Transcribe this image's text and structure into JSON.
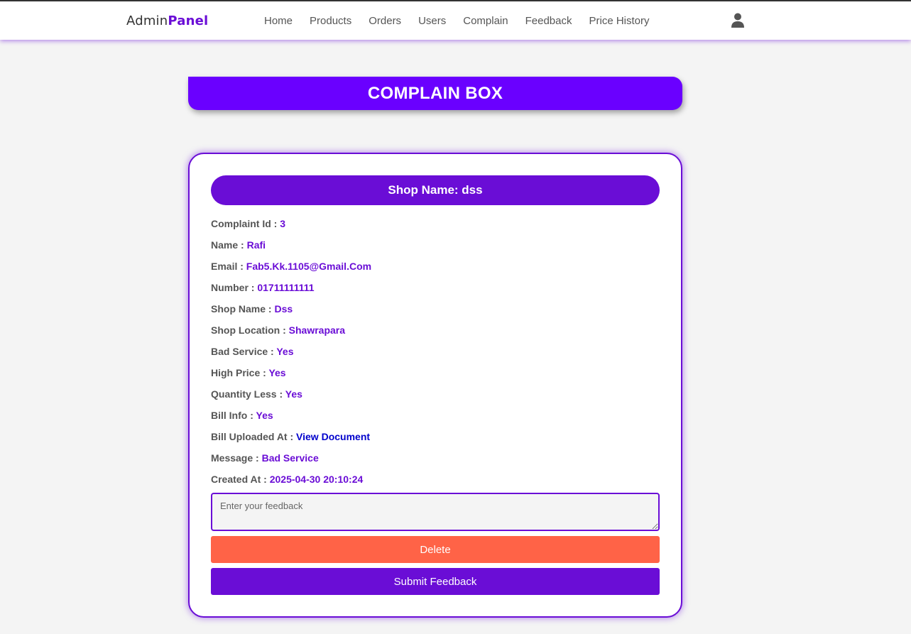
{
  "brand": {
    "part1": "Admin",
    "part2": "Panel"
  },
  "nav": {
    "items": [
      "Home",
      "Products",
      "Orders",
      "Users",
      "Complain",
      "Feedback",
      "Price History"
    ]
  },
  "header": {
    "icon": "user-icon"
  },
  "banner": {
    "title": "COMPLAIN BOX"
  },
  "complaint": {
    "shop_pill": "Shop Name: dss",
    "fields": [
      {
        "label": "Complaint Id : ",
        "value": "3"
      },
      {
        "label": "Name : ",
        "value": "Rafi"
      },
      {
        "label": "Email : ",
        "value": "Fab5.Kk.1105@Gmail.Com"
      },
      {
        "label": "Number : ",
        "value": "01711111111"
      },
      {
        "label": "Shop Name : ",
        "value": "Dss"
      },
      {
        "label": "Shop Location : ",
        "value": "Shawrapara"
      },
      {
        "label": "Bad Service : ",
        "value": "Yes"
      },
      {
        "label": "High Price : ",
        "value": "Yes"
      },
      {
        "label": "Quantity Less : ",
        "value": "Yes"
      },
      {
        "label": "Bill Info : ",
        "value": "Yes"
      },
      {
        "label": "Bill Uploaded At : ",
        "value": "View Document"
      },
      {
        "label": "Message : ",
        "value": "Bad Service"
      },
      {
        "label": "Created At : ",
        "value": "2025-04-30 20:10:24"
      }
    ],
    "feedback_placeholder": "Enter your feedback",
    "feedback_value": "",
    "delete_label": "Delete",
    "submit_label": "Submit Feedback"
  },
  "colors": {
    "accent": "#6a0dd6",
    "banner": "#6a00ff",
    "delete": "#ff6347",
    "link": "#0000cc",
    "background": "#f4f4f4"
  }
}
